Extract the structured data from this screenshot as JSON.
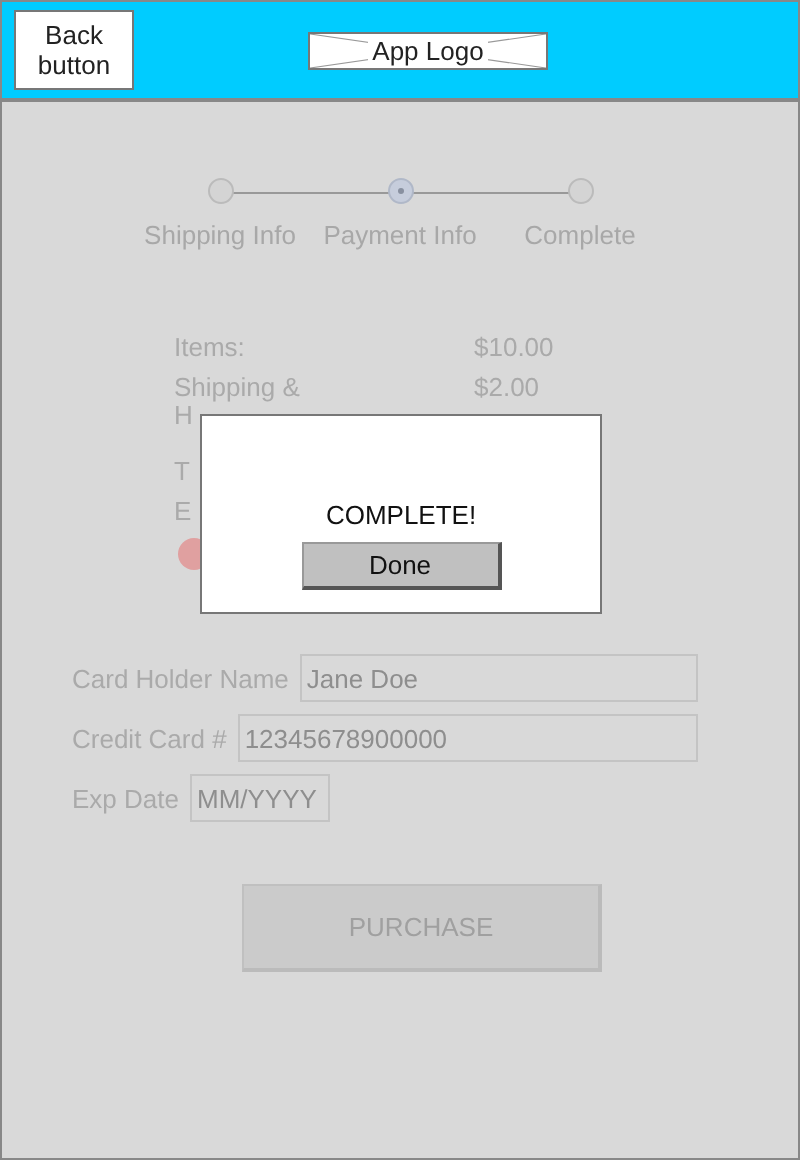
{
  "header": {
    "back_button": "Back button",
    "logo": "App Logo"
  },
  "steps": [
    {
      "label": "Shipping Info",
      "selected": false
    },
    {
      "label": "Payment Info",
      "selected": true
    },
    {
      "label": "Complete",
      "selected": false
    }
  ],
  "summary": [
    {
      "label": "Items:",
      "value": "$10.00"
    },
    {
      "label": "Shipping & H",
      "value": "$2.00"
    },
    {
      "label": "T"
    },
    {
      "label": "E"
    }
  ],
  "fields": [
    {
      "kind": "wide",
      "label": "Card Holder Name",
      "placeholder": "Jane Doe"
    },
    {
      "kind": "wide",
      "label": "Credit Card #",
      "placeholder": "12345678900000"
    },
    {
      "kind": "short",
      "label": "Exp Date",
      "placeholder": "MM/YYYY"
    }
  ],
  "purchase_button": "PURCHASE",
  "dialog": {
    "message": "COMPLETE!",
    "button": "Done"
  }
}
